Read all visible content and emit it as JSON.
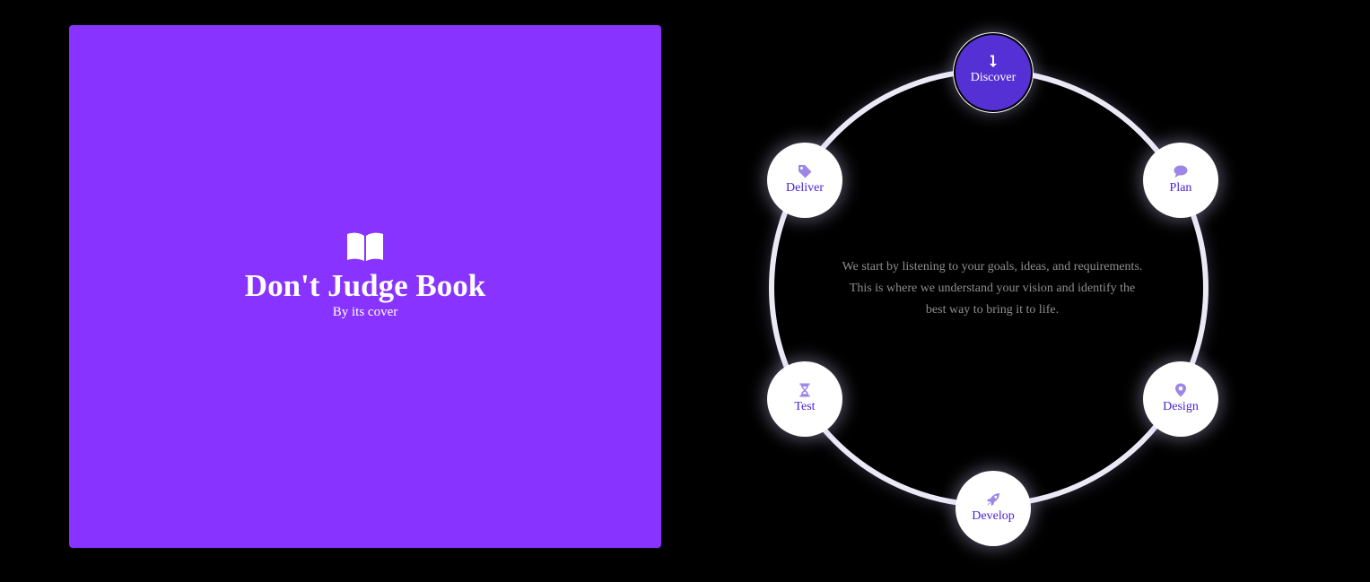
{
  "book": {
    "title": "Don't Judge Book",
    "subtitle": "By its cover",
    "icon": "open-book-icon",
    "background": "#8833ff"
  },
  "process": {
    "description_line1": "We start by listening to your goals, ideas, and requirements.",
    "description_line2": "This is where we understand your vision and identify the",
    "description_line3": "best way to bring it to life.",
    "active_step": "Discover",
    "steps": [
      {
        "label": "Discover",
        "icon": "arrow-down-icon"
      },
      {
        "label": "Plan",
        "icon": "chat-bubble-icon"
      },
      {
        "label": "Design",
        "icon": "map-pin-icon"
      },
      {
        "label": "Develop",
        "icon": "rocket-icon"
      },
      {
        "label": "Test",
        "icon": "hourglass-icon"
      },
      {
        "label": "Deliver",
        "icon": "tag-icon"
      }
    ],
    "colors": {
      "accent": "#5530d5",
      "label": "#4a22d6",
      "icon": "#9d86e6",
      "ring": "#ece9f7",
      "text_muted": "#8e8e8e"
    }
  }
}
